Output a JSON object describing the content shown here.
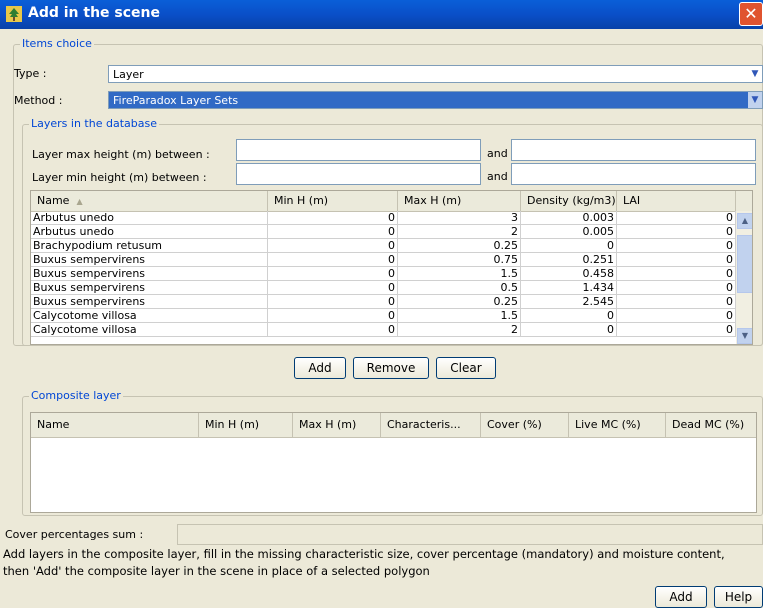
{
  "window": {
    "title": "Add in the scene",
    "close_symbol": "✕"
  },
  "items_choice": {
    "legend": "Items choice",
    "type_label": "Type :",
    "type_value": "Layer",
    "method_label": "Method :",
    "method_value": "FireParadox Layer Sets"
  },
  "database": {
    "legend": "Layers in the database",
    "max_height_label": "Layer max height (m) between :",
    "min_height_label": "Layer min height (m) between :",
    "and_label": "and",
    "columns": [
      "Name",
      "Min H (m)",
      "Max H (m)",
      "Density (kg/m3)",
      "LAI"
    ],
    "sort_indicator": "▲",
    "rows": [
      [
        "Arbutus unedo",
        "0",
        "3",
        "0.003",
        "0"
      ],
      [
        "Arbutus unedo",
        "0",
        "2",
        "0.005",
        "0"
      ],
      [
        "Brachypodium retusum",
        "0",
        "0.25",
        "0",
        "0"
      ],
      [
        "Buxus sempervirens",
        "0",
        "0.75",
        "0.251",
        "0"
      ],
      [
        "Buxus sempervirens",
        "0",
        "1.5",
        "0.458",
        "0"
      ],
      [
        "Buxus sempervirens",
        "0",
        "0.5",
        "1.434",
        "0"
      ],
      [
        "Buxus sempervirens",
        "0",
        "0.25",
        "2.545",
        "0"
      ],
      [
        "Calycotome villosa",
        "0",
        "1.5",
        "0",
        "0"
      ],
      [
        "Calycotome villosa",
        "0",
        "2",
        "0",
        "0"
      ]
    ]
  },
  "buttons": {
    "add": "Add",
    "remove": "Remove",
    "clear": "Clear",
    "add_bottom": "Add",
    "help": "Help"
  },
  "composite": {
    "legend": "Composite layer",
    "columns": [
      "Name",
      "Min H (m)",
      "Max H (m)",
      "Characteris...",
      "Cover (%)",
      "Live MC (%)",
      "Dead MC (%)"
    ]
  },
  "cover_sum_label": "Cover percentages sum :",
  "hint_line1": "Add layers in the composite layer, fill in the missing characteristic size, cover percentage (mandatory) and moisture content,",
  "hint_line2": "then 'Add' the composite layer in the scene in place of a selected polygon",
  "icons": {
    "app": "tree-icon",
    "close": "close-icon",
    "dropdown": "chevron-down-icon",
    "scroll_up": "scroll-up-icon",
    "scroll_down": "scroll-down-icon"
  }
}
